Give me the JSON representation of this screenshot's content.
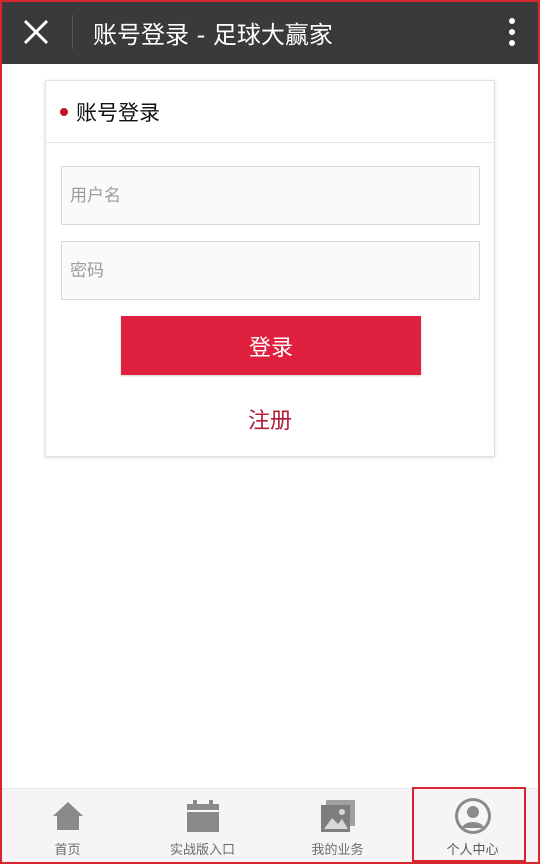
{
  "header": {
    "title": "账号登录 - 足球大赢家",
    "close_icon": "close-icon",
    "menu_icon": "more-vertical-icon"
  },
  "login_card": {
    "title": "账号登录",
    "username_placeholder": "用户名",
    "password_placeholder": "密码",
    "login_label": "登录",
    "register_label": "注册"
  },
  "bottom_nav": {
    "items": [
      {
        "label": "首页",
        "icon": "home-icon"
      },
      {
        "label": "实战版入口",
        "icon": "calendar-icon"
      },
      {
        "label": "我的业务",
        "icon": "gallery-icon"
      },
      {
        "label": "个人中心",
        "icon": "user-avatar-icon"
      }
    ],
    "active_index": 3
  },
  "colors": {
    "header_bg": "#3a3a3c",
    "accent_red": "#e0203f",
    "register_red": "#b01d35",
    "highlight_border": "#d8262f"
  }
}
